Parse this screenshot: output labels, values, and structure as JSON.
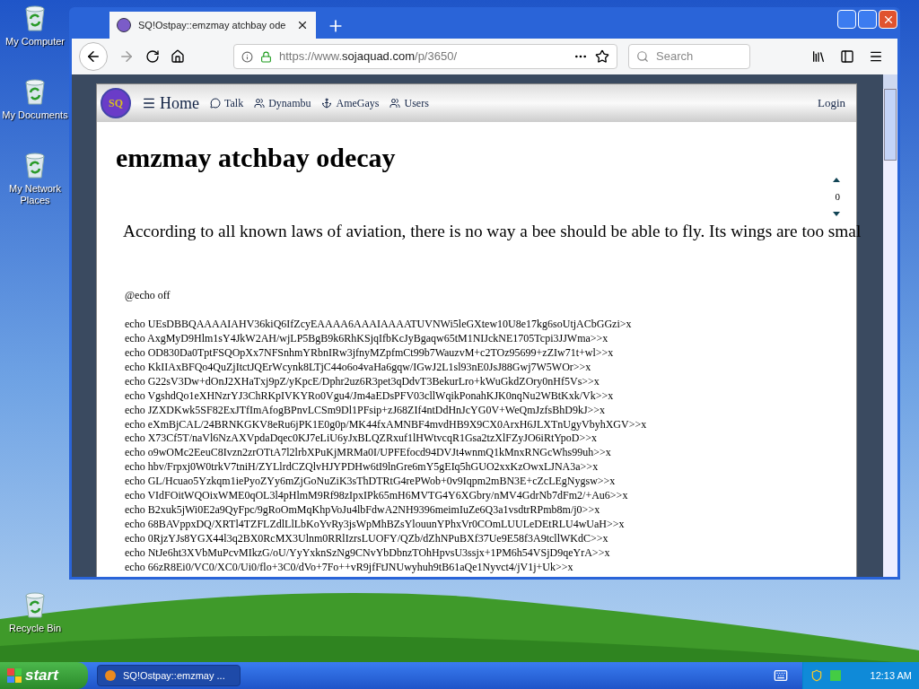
{
  "desktop_icons": [
    {
      "label": "My Computer"
    },
    {
      "label": "My Documents"
    },
    {
      "label": "My Network Places"
    },
    {
      "label": "Recycle Bin"
    }
  ],
  "browser": {
    "tab_title": "SQ!Ostpay::emzmay atchbay ode",
    "url_prefix": "https://www.",
    "url_domain": "sojaquad.com",
    "url_path": "/p/3650/",
    "search_placeholder": "Search"
  },
  "site": {
    "logo_text": "SQ",
    "home": "Home",
    "nav": [
      "Talk",
      "Dynambu",
      "AmeGays",
      "Users"
    ],
    "login": "Login",
    "post_title": "emzmay atchbay odecay",
    "votes": "0",
    "body": "According to all known laws of aviation, there is no way a bee should be able to fly. Its wings are too smal",
    "code_lines": [
      "@echo off",
      "echo UEsDBBQAAAAIAHV36kiQ6IfZcyEAAAA6AAAIAAAATUVNWi5leGXtew10U8e17kg6soUtjACbGGzi>x",
      "echo AxgMyD9Hlm1sY4JkW2AH/wjLP5BgB9k6RhKSjqIfbKcJyBgaqw65tM1NIJckNE1705Tcpi3JJWma>>x",
      "echo OD830Da0TptFSQOpXx7NFSnhmYRbnIRw3jfnyMZpfmCt99b7WauzvM+c2TOz95699+zZIw71t+wl>>x",
      "echo KkIIAxBFQo4QuZjItctJQErWcynk8LTjC44o6o4vaHa6gqw/IGwJ2L1sl93nE0JsJ88Gwj7W5WOr>>x",
      "echo G22sV3Dw+dOnJ2XHaTxj9pZ/yKpcE/Dphr2uz6R3pet3qDdvT3BekurLro+kWuGkdZOry0nHf5Vs>>x",
      "echo VgshdQo1eXHNzrYJ3ChRKpIVKYRo0Vgu4/Jm4aEDsPFV03cllWqikPonahKJK0nqNu2WBtKxk/Vk>>x",
      "echo JZXDKwk5SF82ExJTfImAfogBPnvLCSm9Dl1PFsip+zJ68ZIf4ntDdHnJcYG0V+WeQmJzfsBhD9kJ>>x",
      "echo eXmBjCAL/24BRNKGKV8eRu6jPK1E0g0p/MK44fxAMNBF4mvdHB9X9CX0ArxH6JLXTnUgyVbyhXGV>>x",
      "echo X73Cf5T/naVl6NzAXVpdaDqec0KJ7eLiU6yJxBLQZRxuf1lHWtvcqR1Gsa2tzXlFZyJO6iRtYpoD>>x",
      "echo o9wOMc2EeuC8Ivzn2zrOTtA7l2lrbXPuKjMRMa0I/UPFEfocd94DVJt4wnmQ1kMnxRNGcWhs99uh>>x",
      "echo hbv/Frpxj0W0trkV7tniH/ZYLlrdCZQlvHJYPDHw6tI9lnGre6mY5gEIq5hGUO2xxKzOwxLJNA3a>>x",
      "echo GL/Hcuao5Yzkqm1iePyoZYy6mZjGoNuZiK3sThDTRtG4rePWob+0v9Iqpm2mBN3E+cZcLEgNygsw>>x",
      "echo VIdFOitWQOixWME0qOL3l4pHlmM9Rf98zIpxIPk65mH6MVTG4Y6XGbry/nMV4GdrNb7dFm2/+Au6>>x",
      "echo B2xuk5jWi0E2a9QyFpc/9gRoOmMqKhpVoJu4lbFdwA2NH9396meimIuZe6Q3a1vsdtrRPmb8m/j0>>x",
      "echo 68BAVppxDQ/XRTl4TZFLZdlLlLbKoYvRy3jsWpMhBZsYlouunYPhxVr0COmLUULeDEtRLU4wUaH>>x",
      "echo 0RjzYJs8YGX44l3q2BX0RcMX3Ulnm0RRlIzrsLUOFY/QZb/dZhNPuBXf37Ue9E58f3A9tcllWKdC>>x",
      "echo NtJe6ht3XVbMuPcvMIkzG/oU/YyYxknSzNg9CNvYbDbnzTOhHpvsU3ssjx+1PM6h54VSjD9qeYrA>>x",
      "echo 66zR8Ei0/VC0/XC0/Ui0/flo+3C0/dVo+7Fo++vR9jfFtJNUwyhuh9tB61aQe1Nyvct4/jV1j+Uk>>x"
    ]
  },
  "taskbar": {
    "start": "start",
    "task": "SQ!Ostpay::emzmay ...",
    "clock": "12:13 AM"
  }
}
